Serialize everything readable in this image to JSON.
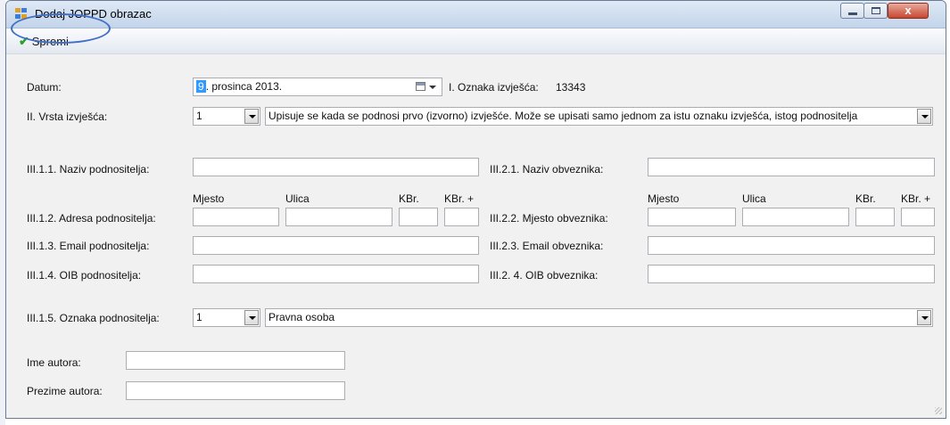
{
  "window": {
    "title": "Dodaj JOPPD obrazac",
    "close_glyph": "x"
  },
  "toolbar": {
    "save_label": "Spremi"
  },
  "datum": {
    "label": "Datum:",
    "day": "9",
    "rest": ". prosinca 2013."
  },
  "oznaka": {
    "label": "I. Oznaka izvješća:",
    "value": "13343"
  },
  "vrsta": {
    "label": "II. Vrsta izvješća:",
    "code": "1",
    "description": "Upisuje se kada se podnosi prvo (izvorno) izvješće. Može se upisati samo jednom za istu oznaku izvješća, istog podnositelja"
  },
  "podnositelj": {
    "naziv_label": "III.1.1. Naziv podnositelja:",
    "adresa_label": "III.1.2. Adresa podnositelja:",
    "email_label": "III.1.3. Email podnositelja:",
    "oib_label": "III.1.4. OIB podnositelja:",
    "oznaka_label": "III.1.5. Oznaka podnositelja:",
    "oznaka_code": "1",
    "oznaka_value": "Pravna osoba"
  },
  "obveznik": {
    "naziv_label": "III.2.1. Naziv obveznika:",
    "mjesto_label": "III.2.2. Mjesto obveznika:",
    "email_label": "III.2.3. Email obveznika:",
    "oib_label": "III.2. 4. OIB obveznika:"
  },
  "address_headers": {
    "mjesto": "Mjesto",
    "ulica": "Ulica",
    "kbr": "KBr.",
    "kbr_plus": "KBr. +"
  },
  "autor": {
    "ime_label": "Ime autora:",
    "prezime_label": "Prezime autora:"
  },
  "icons": {
    "app": "form-icon",
    "save": "checkmark-icon",
    "calendar": "calendar-icon"
  },
  "colors": {
    "accent": "#3f6fc7",
    "check": "#2aa12a",
    "selection": "#3399ff"
  }
}
